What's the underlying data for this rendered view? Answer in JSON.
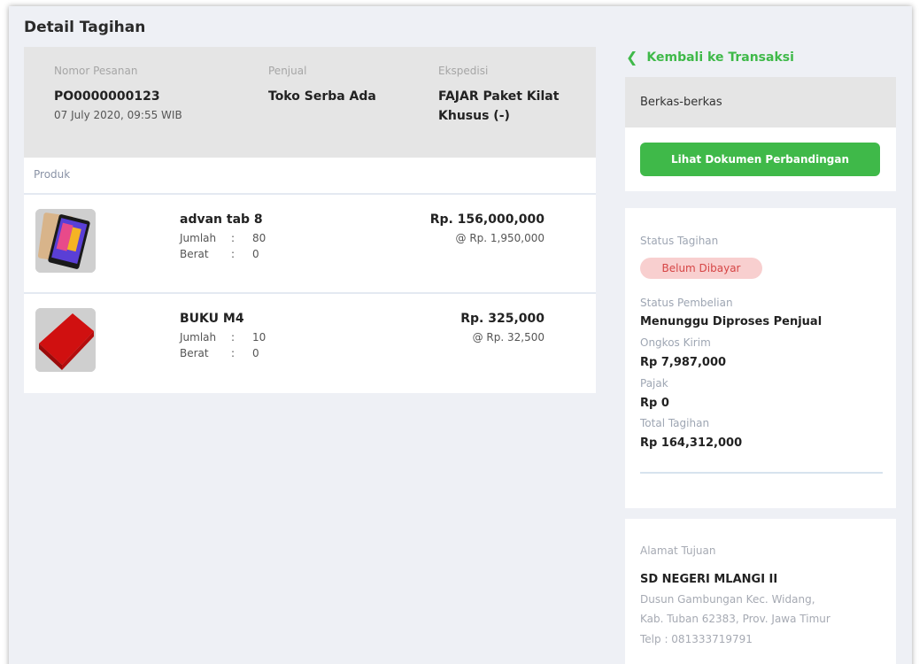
{
  "page_title": "Detail Tagihan",
  "order": {
    "nomor_label": "Nomor Pesanan",
    "nomor_value": "PO0000000123",
    "tanggal": "07 July 2020, 09:55 WIB",
    "penjual_label": "Penjual",
    "penjual_value": "Toko Serba Ada",
    "ekspedisi_label": "Ekspedisi",
    "ekspedisi_line1": "FAJAR Paket Kilat",
    "ekspedisi_line2": "Khusus (-)"
  },
  "produk_label": "Produk",
  "products": [
    {
      "name": "advan tab 8",
      "jumlah_label": "Jumlah",
      "jumlah_value": "80",
      "berat_label": "Berat",
      "berat_value": "0",
      "separator": ":",
      "price": "Rp. 156,000,000",
      "unit_price": "@ Rp. 1,950,000"
    },
    {
      "name": "BUKU M4",
      "jumlah_label": "Jumlah",
      "jumlah_value": "10",
      "berat_label": "Berat",
      "berat_value": "0",
      "separator": ":",
      "price": "Rp. 325,000",
      "unit_price": "@ Rp. 32,500"
    }
  ],
  "back_link": "Kembali ke Transaksi",
  "berkas": {
    "title": "Berkas-berkas",
    "button": "Lihat Dokumen Perbandingan"
  },
  "status": {
    "tagihan_label": "Status Tagihan",
    "tagihan_badge": "Belum Dibayar",
    "pembelian_label": "Status Pembelian",
    "pembelian_value": "Menunggu Diproses Penjual",
    "ongkir_label": "Ongkos Kirim",
    "ongkir_value": "Rp 7,987,000",
    "pajak_label": "Pajak",
    "pajak_value": "Rp 0",
    "total_label": "Total Tagihan",
    "total_value": "Rp 164,312,000"
  },
  "alamat": {
    "label": "Alamat Tujuan",
    "name": "SD NEGERI MLANGI II",
    "line1": "Dusun Gambungan Kec. Widang,",
    "line2": "Kab. Tuban 62383, Prov. Jawa Timur",
    "telp": "Telp : 081333719791"
  },
  "colors": {
    "accent_green": "#3fb949",
    "badge_bg": "#f8cfcf",
    "badge_text": "#d64545",
    "background": "#eef0f5"
  },
  "icons": {
    "back": "chevron-left-icon",
    "product1": "tablet-image",
    "product2": "book-image"
  }
}
